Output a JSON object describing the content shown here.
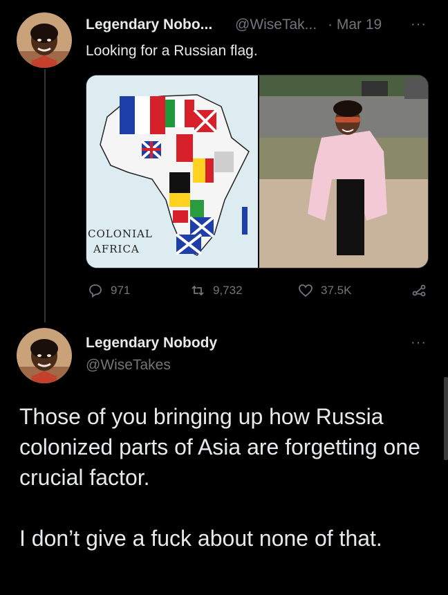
{
  "reply_tweet": {
    "author_name": "Legendary Nobo...",
    "handle": "@WiseTak...",
    "date": "· Mar 19",
    "more": "···",
    "text": "Looking for a Russian flag.",
    "media": {
      "map_caption_line1": "COLONIAL",
      "map_caption_line2": "AFRICA"
    },
    "actions": {
      "replies": "971",
      "retweets": "9,732",
      "likes": "37.5K"
    }
  },
  "main_tweet": {
    "author_name": "Legendary Nobody",
    "handle": "@WiseTakes",
    "more": "···",
    "text_p1": "Those of you bringing up how Russia colonized parts of Asia are forgetting one crucial factor.",
    "text_p2": "I don’t give a fuck about none of that."
  },
  "colors": {
    "background": "#000000",
    "text": "#e7e9ea",
    "muted": "#71767b"
  }
}
